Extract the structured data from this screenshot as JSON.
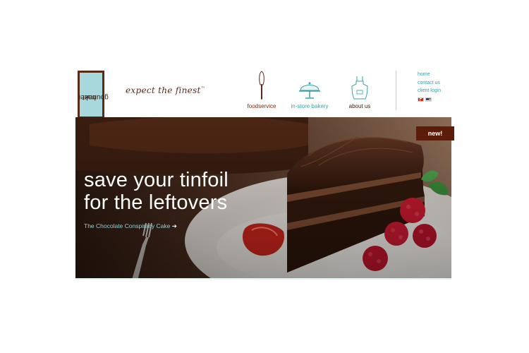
{
  "logo": {
    "line1": "gourmet",
    "line2": "baker",
    "monogram": "g",
    "icon": "gourmet-baker-logo"
  },
  "tagline": {
    "text": "expect the finest",
    "mark": "™"
  },
  "nav": {
    "items": [
      {
        "label": "foodservice",
        "icon": "cake-server-icon"
      },
      {
        "label": "in-store bakery",
        "icon": "cake-stand-icon"
      },
      {
        "label": "about us",
        "icon": "apron-icon"
      }
    ]
  },
  "utility": {
    "links": [
      "home",
      "contact us",
      "client login"
    ],
    "flags": [
      "canada-flag-icon",
      "usa-flag-icon"
    ]
  },
  "hero": {
    "title_line1": "save your tinfoil",
    "title_line2": "for the leftovers",
    "product_link": "The Chocolate Conspiracy Cake",
    "arrow": "➔"
  },
  "badge": {
    "label": "new!"
  },
  "colors": {
    "brand_brown": "#5a2a18",
    "brand_teal": "#a8d8dc",
    "link_teal": "#3aa0a6",
    "badge_red": "#5c1c0a"
  }
}
